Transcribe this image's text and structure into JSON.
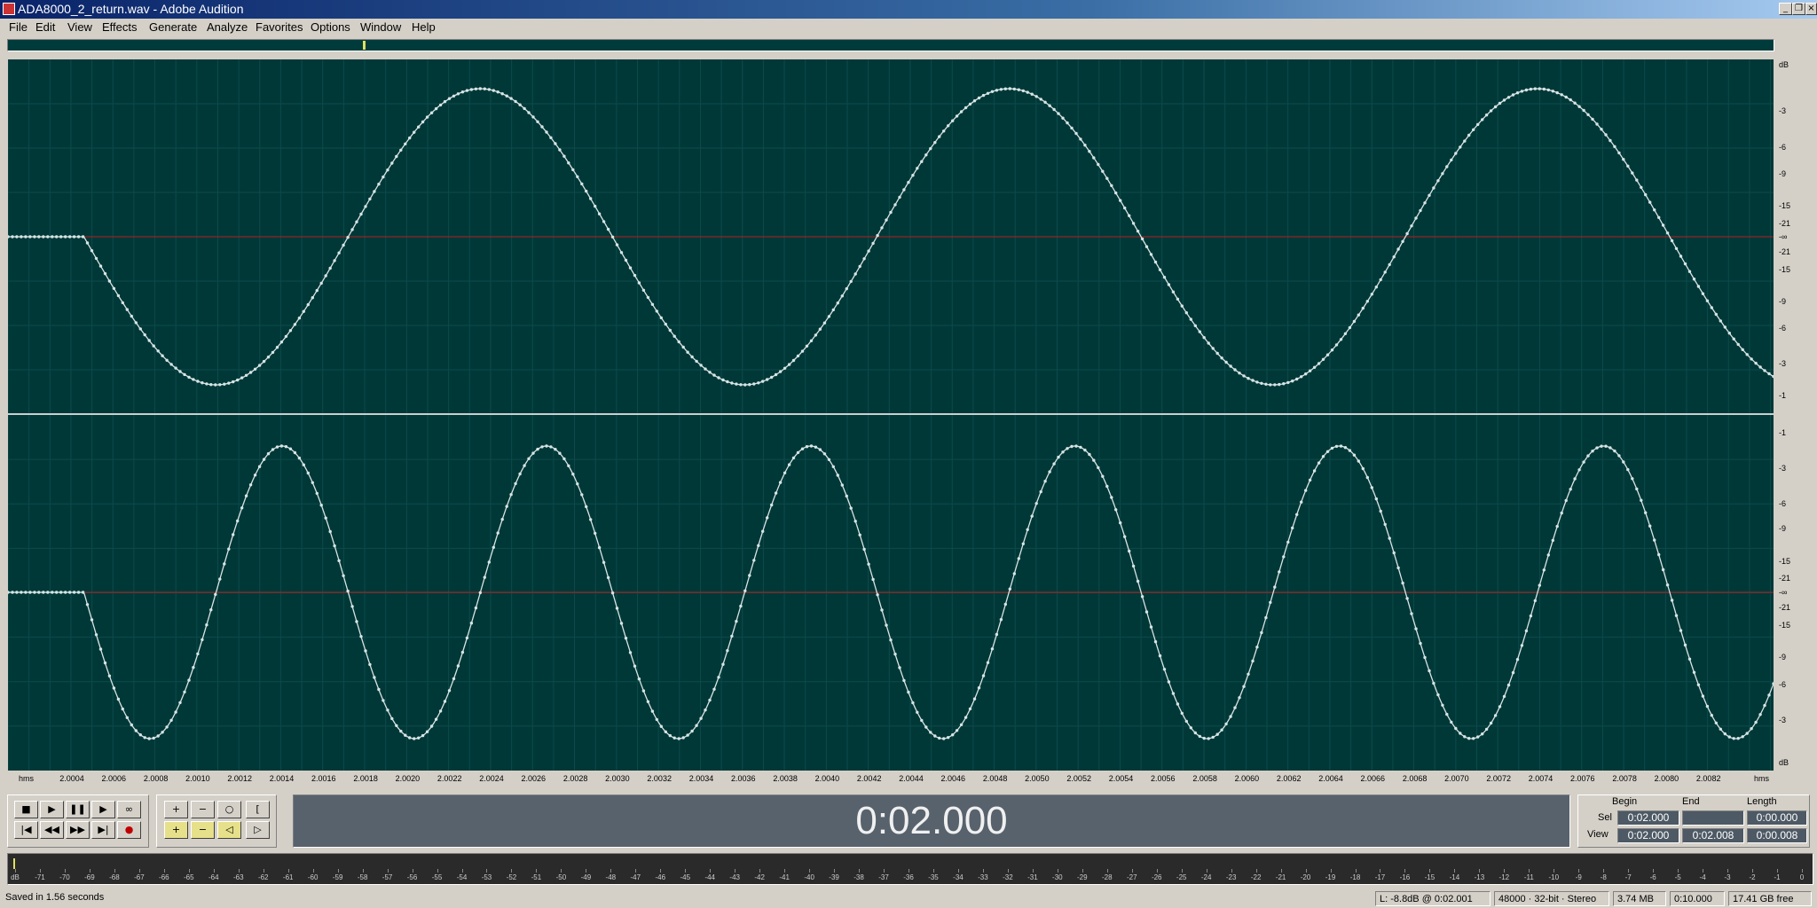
{
  "window": {
    "title": "ADA8000_2_return.wav - Adobe Audition",
    "minimize": "_",
    "restore": "❐",
    "close": "×"
  },
  "menu": [
    "File",
    "Edit",
    "View",
    "Effects",
    "Generate",
    "Analyze",
    "Favorites",
    "Options",
    "Window",
    "Help"
  ],
  "db_scale": {
    "top": [
      "dB",
      "-3",
      "-6",
      "-9",
      "-15",
      "-21",
      "-∞",
      "-21",
      "-15",
      "-9",
      "-6",
      "-3",
      "-1"
    ],
    "bottom": [
      "-1",
      "-3",
      "-6",
      "-9",
      "-15",
      "-21",
      "-∞",
      "-21",
      "-15",
      "-9",
      "-6",
      "-3",
      "dB"
    ]
  },
  "time_ruler": {
    "left_unit": "hms",
    "right_unit": "hms",
    "ticks": [
      "2.0004",
      "2.0006",
      "2.0008",
      "2.0010",
      "2.0012",
      "2.0014",
      "2.0016",
      "2.0018",
      "2.0020",
      "2.0022",
      "2.0024",
      "2.0026",
      "2.0028",
      "2.0030",
      "2.0032",
      "2.0034",
      "2.0036",
      "2.0038",
      "2.0040",
      "2.0042",
      "2.0044",
      "2.0046",
      "2.0048",
      "2.0050",
      "2.0052",
      "2.0054",
      "2.0056",
      "2.0058",
      "2.0060",
      "2.0062",
      "2.0064",
      "2.0066",
      "2.0068",
      "2.0070",
      "2.0072",
      "2.0074",
      "2.0076",
      "2.0078",
      "2.0080",
      "2.0082"
    ]
  },
  "transport": {
    "stop": "■",
    "play": "▶",
    "pause": "❚❚",
    "play_to_end": "▶",
    "loop": "∞",
    "go_start": "|◀",
    "rewind": "◀◀",
    "forward": "▶▶",
    "go_end": "▶|",
    "record": "●",
    "zoom_in_h": "+",
    "zoom_out_h": "−",
    "zoom_full": "○",
    "zoom_sel": "[",
    "zoom_in_v": "+",
    "zoom_out_v": "−",
    "zoom_left": "◁",
    "zoom_right": "▷"
  },
  "time_display": "0:02.000",
  "selection": {
    "header_begin": "Begin",
    "header_end": "End",
    "header_length": "Length",
    "sel_label": "Sel",
    "view_label": "View",
    "sel_begin": "0:02.000",
    "sel_end": "",
    "sel_length": "0:00.000",
    "view_begin": "0:02.000",
    "view_end": "0:02.008",
    "view_length": "0:00.008"
  },
  "level_meter": {
    "labels": [
      "dB",
      "-71",
      "-70",
      "-69",
      "-68",
      "-67",
      "-66",
      "-65",
      "-64",
      "-63",
      "-62",
      "-61",
      "-60",
      "-59",
      "-58",
      "-57",
      "-56",
      "-55",
      "-54",
      "-53",
      "-52",
      "-51",
      "-50",
      "-49",
      "-48",
      "-47",
      "-46",
      "-45",
      "-44",
      "-43",
      "-42",
      "-41",
      "-40",
      "-39",
      "-38",
      "-37",
      "-36",
      "-35",
      "-34",
      "-33",
      "-32",
      "-31",
      "-30",
      "-29",
      "-28",
      "-27",
      "-26",
      "-25",
      "-24",
      "-23",
      "-22",
      "-21",
      "-20",
      "-19",
      "-18",
      "-17",
      "-16",
      "-15",
      "-14",
      "-13",
      "-12",
      "-11",
      "-10",
      "-9",
      "-8",
      "-7",
      "-6",
      "-5",
      "-4",
      "-3",
      "-2",
      "-1",
      "0"
    ]
  },
  "status": {
    "message": "Saved in 1.56 seconds",
    "level": "L: -8.8dB @  0:02.001",
    "format": "48000 · 32-bit · Stereo",
    "size": "3.74 MB",
    "duration": "0:10.000",
    "free": "17.41 GB free"
  },
  "colors": {
    "wave_bg": "#003838",
    "wave_line": "#d8e4e4",
    "center_line": "#b81e1e"
  },
  "waveform": {
    "ch1_cycles": 3.34,
    "ch2_cycles": 6.68,
    "onset_fraction": 0.043,
    "peak_level": 0.988
  }
}
